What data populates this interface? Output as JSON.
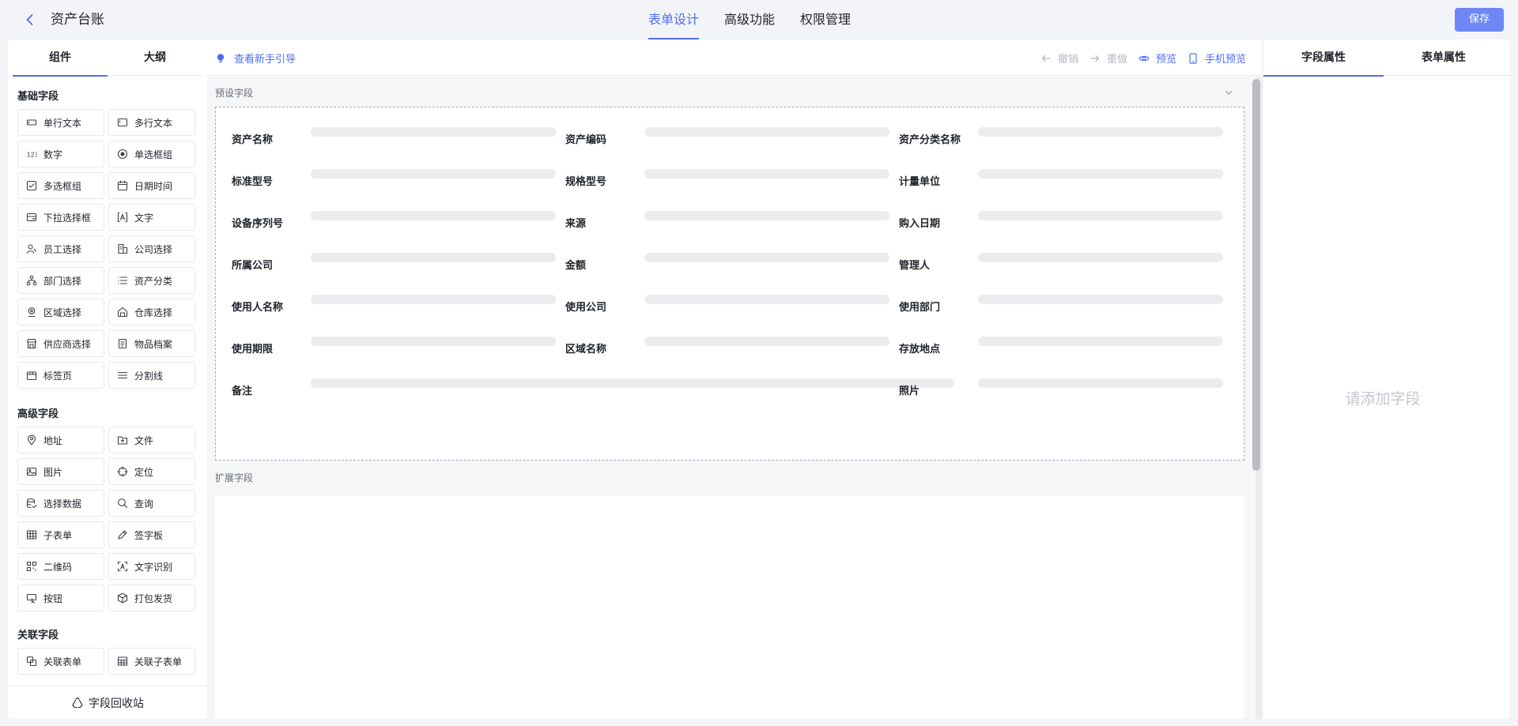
{
  "header": {
    "back_icon": "chevron-left-icon",
    "title": "资产台账",
    "tabs": [
      {
        "label": "表单设计",
        "active": true
      },
      {
        "label": "高级功能",
        "active": false
      },
      {
        "label": "权限管理",
        "active": false
      }
    ],
    "save_label": "保存",
    "accent_color": "#4e6ef2"
  },
  "left_panel": {
    "tabs": [
      {
        "label": "组件",
        "active": true
      },
      {
        "label": "大纲",
        "active": false
      }
    ],
    "groups": [
      {
        "title": "基础字段",
        "items": [
          {
            "label": "单行文本",
            "icon": "single-line-text-icon"
          },
          {
            "label": "多行文本",
            "icon": "multi-line-text-icon"
          },
          {
            "label": "数字",
            "icon": "number-icon"
          },
          {
            "label": "单选框组",
            "icon": "radio-icon"
          },
          {
            "label": "多选框组",
            "icon": "checkbox-icon"
          },
          {
            "label": "日期时间",
            "icon": "calendar-icon"
          },
          {
            "label": "下拉选择框",
            "icon": "dropdown-icon"
          },
          {
            "label": "文字",
            "icon": "text-icon"
          },
          {
            "label": "员工选择",
            "icon": "user-icon"
          },
          {
            "label": "公司选择",
            "icon": "building-icon"
          },
          {
            "label": "部门选择",
            "icon": "org-chart-icon"
          },
          {
            "label": "资产分类",
            "icon": "list-icon"
          },
          {
            "label": "区域选择",
            "icon": "location-icon"
          },
          {
            "label": "仓库选择",
            "icon": "warehouse-icon"
          },
          {
            "label": "供应商选择",
            "icon": "store-icon"
          },
          {
            "label": "物品档案",
            "icon": "archive-icon"
          },
          {
            "label": "标签页",
            "icon": "tab-icon"
          },
          {
            "label": "分割线",
            "icon": "divider-icon"
          }
        ]
      },
      {
        "title": "高级字段",
        "items": [
          {
            "label": "地址",
            "icon": "pin-icon"
          },
          {
            "label": "文件",
            "icon": "folder-icon"
          },
          {
            "label": "图片",
            "icon": "image-icon"
          },
          {
            "label": "定位",
            "icon": "crosshair-icon"
          },
          {
            "label": "选择数据",
            "icon": "database-icon"
          },
          {
            "label": "查询",
            "icon": "search-icon"
          },
          {
            "label": "子表单",
            "icon": "table-icon"
          },
          {
            "label": "签字板",
            "icon": "pen-icon"
          },
          {
            "label": "二维码",
            "icon": "qrcode-icon"
          },
          {
            "label": "文字识别",
            "icon": "ocr-icon"
          },
          {
            "label": "按钮",
            "icon": "button-icon"
          },
          {
            "label": "打包发货",
            "icon": "package-icon"
          }
        ]
      },
      {
        "title": "关联字段",
        "items": [
          {
            "label": "关联表单",
            "icon": "link-form-icon"
          },
          {
            "label": "关联子表单",
            "icon": "link-subtable-icon"
          }
        ]
      }
    ],
    "recycle_label": "字段回收站"
  },
  "toolbar": {
    "guide_label": "查看新手引导",
    "undo_label": "撤销",
    "redo_label": "重做",
    "preview_label": "预览",
    "mobile_preview_label": "手机预览"
  },
  "canvas": {
    "preset_label": "预设字段",
    "extension_label": "扩展字段",
    "fields": [
      [
        "资产名称",
        "资产编码",
        "资产分类名称"
      ],
      [
        "标准型号",
        "规格型号",
        "计量单位"
      ],
      [
        "设备序列号",
        "来源",
        "购入日期"
      ],
      [
        "所属公司",
        "金额",
        "管理人"
      ],
      [
        "使用人名称",
        "使用公司",
        "使用部门"
      ],
      [
        "使用期限",
        "区域名称",
        "存放地点"
      ],
      [
        "备注",
        "照片"
      ]
    ]
  },
  "right_panel": {
    "tabs": [
      {
        "label": "字段属性",
        "active": true
      },
      {
        "label": "表单属性",
        "active": false
      }
    ],
    "empty_hint": "请添加字段"
  }
}
